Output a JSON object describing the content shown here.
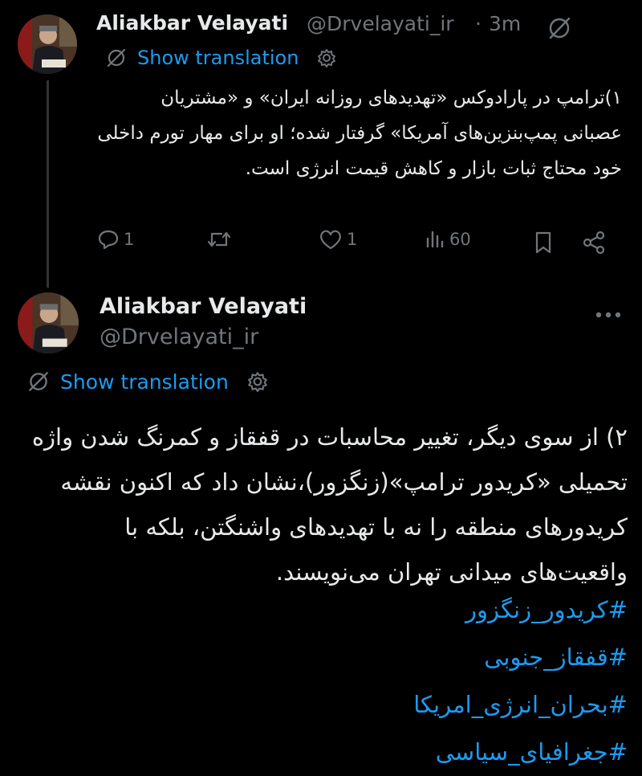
{
  "tweet1": {
    "author_name": "Aliakbar Velayati",
    "handle": "@Drvelayati_ir",
    "separator": "·",
    "time": "3m",
    "translate_label": "Show translation",
    "text": "۱)ترامپ در پارادوکس «تهدیدهای روزانه ایران» و «مشتریان عصبانی پمپ‌بنزین‌های آمریکا» گرفتار شده؛ او برای مهار تورم داخلی خود محتاج ثبات بازار و کاهش قیمت انرژی است.",
    "stats": {
      "replies": "1",
      "retweets": "",
      "likes": "1",
      "views": "60"
    },
    "icons": [
      "grok-icon",
      "reply-icon",
      "retweet-icon",
      "like-icon",
      "views-icon",
      "bookmark-icon",
      "share-icon"
    ]
  },
  "tweet2": {
    "author_name": "Aliakbar Velayati",
    "handle": "@Drvelayati_ir",
    "translate_label": "Show translation",
    "text": "۲) از سوی دیگر، تغییر محاسبات در قفقاز و کمرنگ شدن واژه تحمیلی «کریدور ترامپ»(زنگزور)،نشان داد که اکنون نقشه کریدورهای منطقه را نه با تهدیدهای  واشنگتن، بلکه با واقعیت‌های میدانی تهران می‌نویسند.",
    "hashtags": [
      "#کریدور_زنگزور",
      "#قفقاز_جنوبی",
      "#بحران_انرژی_امریکا",
      "#جغرافیای_سیاسی"
    ],
    "icons": [
      "more-icon"
    ]
  },
  "colors": {
    "background": "#000000",
    "text": "#e7e9ea",
    "muted": "#71767b",
    "accent": "#1d9bf0",
    "divider": "#2f3336"
  }
}
